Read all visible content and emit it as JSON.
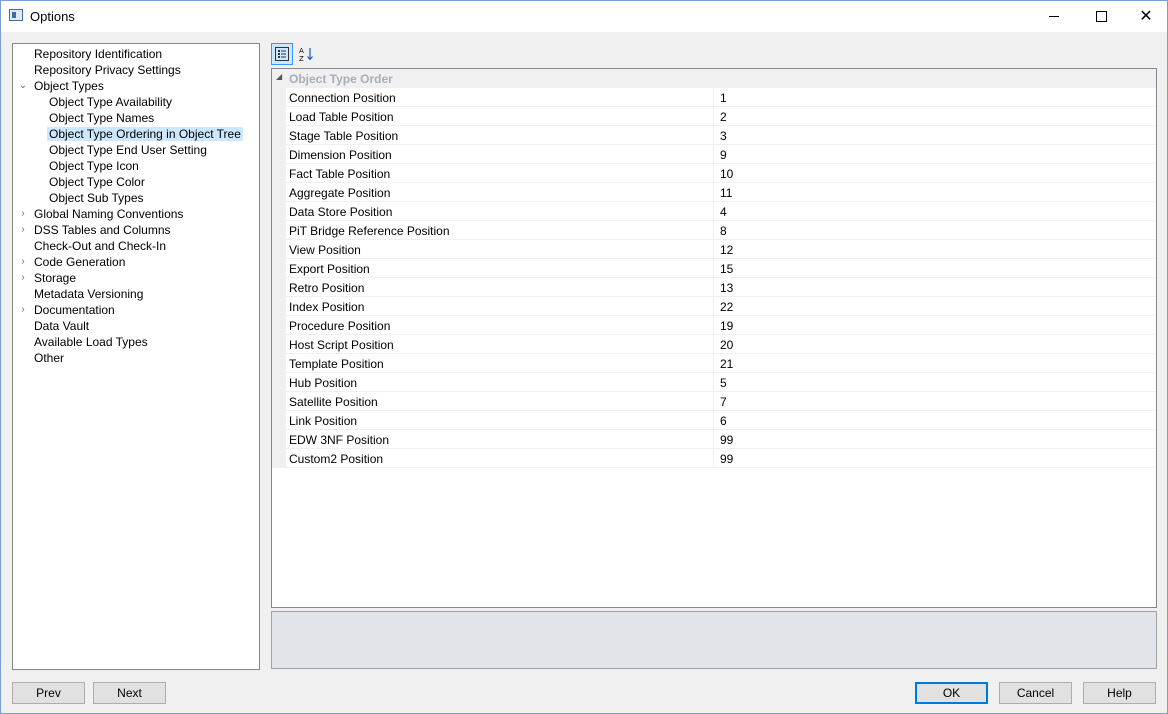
{
  "window": {
    "title": "Options"
  },
  "tree": {
    "items": [
      {
        "label": "Repository Identification"
      },
      {
        "label": "Repository Privacy Settings"
      },
      {
        "label": "Object Types"
      },
      {
        "label": "Object Type Availability"
      },
      {
        "label": "Object Type Names"
      },
      {
        "label": "Object Type Ordering in Object Tree"
      },
      {
        "label": "Object Type End User Setting"
      },
      {
        "label": "Object Type Icon"
      },
      {
        "label": "Object Type Color"
      },
      {
        "label": "Object Sub Types"
      },
      {
        "label": "Global Naming Conventions"
      },
      {
        "label": "DSS Tables and Columns"
      },
      {
        "label": "Check-Out and Check-In"
      },
      {
        "label": "Code Generation"
      },
      {
        "label": "Storage"
      },
      {
        "label": "Metadata Versioning"
      },
      {
        "label": "Documentation"
      },
      {
        "label": "Data Vault"
      },
      {
        "label": "Available Load Types"
      },
      {
        "label": "Other"
      }
    ]
  },
  "toolbar": {
    "categorized_icon": "categorized-icon",
    "alphabetical_icon": "sort-alphabetical-icon"
  },
  "grid": {
    "category": "Object Type Order",
    "rows": [
      {
        "name": "Connection Position",
        "value": "1"
      },
      {
        "name": "Load Table Position",
        "value": "2"
      },
      {
        "name": "Stage Table Position",
        "value": "3"
      },
      {
        "name": "Dimension Position",
        "value": "9"
      },
      {
        "name": "Fact Table Position",
        "value": "10"
      },
      {
        "name": "Aggregate Position",
        "value": "11"
      },
      {
        "name": "Data Store Position",
        "value": "4"
      },
      {
        "name": "PiT Bridge Reference Position",
        "value": "8"
      },
      {
        "name": "View Position",
        "value": "12"
      },
      {
        "name": "Export Position",
        "value": "15"
      },
      {
        "name": "Retro Position",
        "value": "13"
      },
      {
        "name": "Index Position",
        "value": "22"
      },
      {
        "name": "Procedure Position",
        "value": "19"
      },
      {
        "name": "Host Script Position",
        "value": "20"
      },
      {
        "name": "Template Position",
        "value": "21"
      },
      {
        "name": "Hub Position",
        "value": "5"
      },
      {
        "name": "Satellite Position",
        "value": "7"
      },
      {
        "name": "Link Position",
        "value": "6"
      },
      {
        "name": "EDW 3NF Position",
        "value": "99"
      },
      {
        "name": "Custom2 Position",
        "value": "99"
      }
    ]
  },
  "buttons": {
    "prev": "Prev",
    "next": "Next",
    "ok": "OK",
    "cancel": "Cancel",
    "help": "Help"
  }
}
